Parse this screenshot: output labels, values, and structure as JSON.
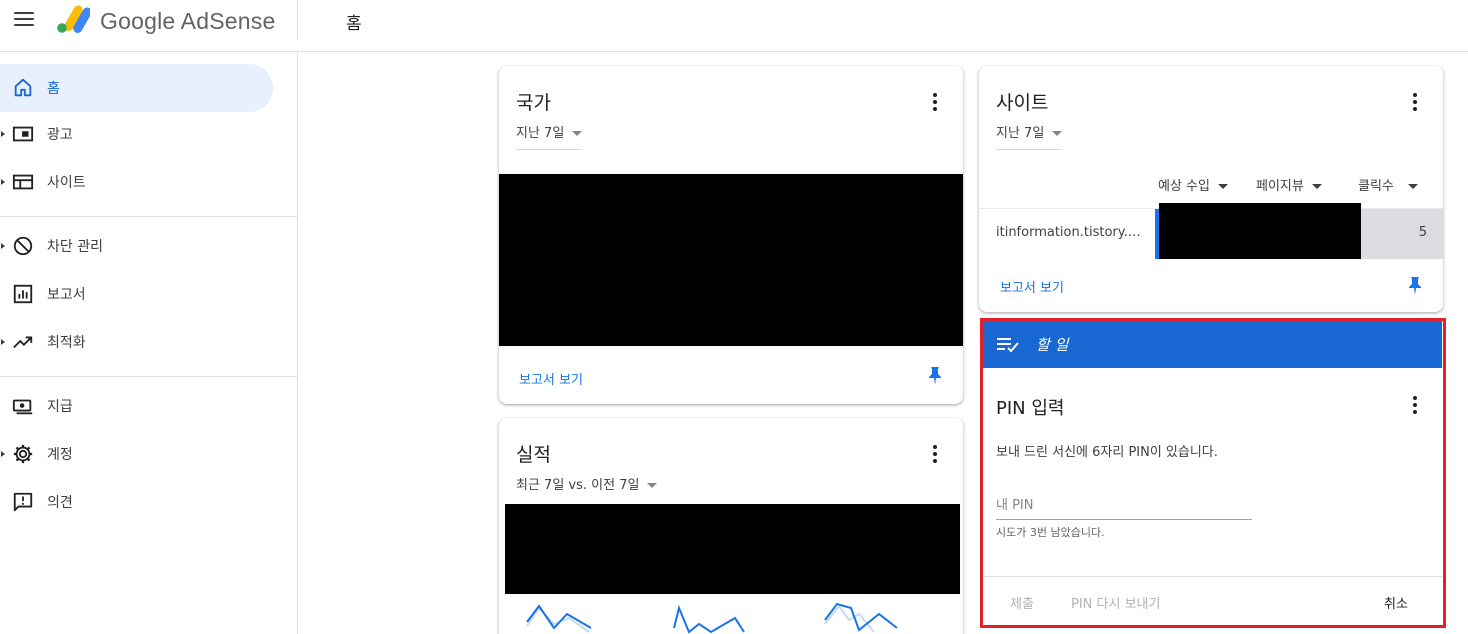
{
  "app": {
    "logo_text": "Google AdSense",
    "page_title": "홈"
  },
  "sidebar": {
    "items": [
      {
        "label": "홈",
        "icon": "home-icon",
        "active": true
      },
      {
        "label": "광고",
        "icon": "ads-icon"
      },
      {
        "label": "사이트",
        "icon": "sites-icon"
      },
      {
        "label": "차단 관리",
        "icon": "block-icon"
      },
      {
        "label": "보고서",
        "icon": "reports-icon"
      },
      {
        "label": "최적화",
        "icon": "trending-icon"
      },
      {
        "label": "지급",
        "icon": "payments-icon"
      },
      {
        "label": "계정",
        "icon": "gear-icon"
      },
      {
        "label": "의견",
        "icon": "feedback-icon"
      }
    ]
  },
  "cards": {
    "country": {
      "title": "국가",
      "period": "지난 7일",
      "report_link": "보고서 보기"
    },
    "performance": {
      "title": "실적",
      "period": "최근 7일 vs. 이전 7일"
    },
    "site": {
      "title": "사이트",
      "period": "지난 7일",
      "columns": [
        "예상 수입",
        "페이지뷰",
        "클릭수"
      ],
      "rows": [
        {
          "site": "itinformation.tistory.c...",
          "clicks": "5"
        }
      ],
      "report_link": "보고서 보기"
    },
    "todo": {
      "header": "할 일",
      "title": "PIN 입력",
      "description": "보내 드린 서신에 6자리 PIN이 있습니다.",
      "input_placeholder": "내 PIN",
      "hint": "시도가 3번 남았습니다.",
      "submit_label": "제출",
      "resend_label": "PIN 다시 보내기",
      "cancel_label": "취소"
    }
  },
  "colors": {
    "accent": "#1a73e8",
    "header_blue": "#1967d2",
    "highlight_border": "#e0202a"
  }
}
